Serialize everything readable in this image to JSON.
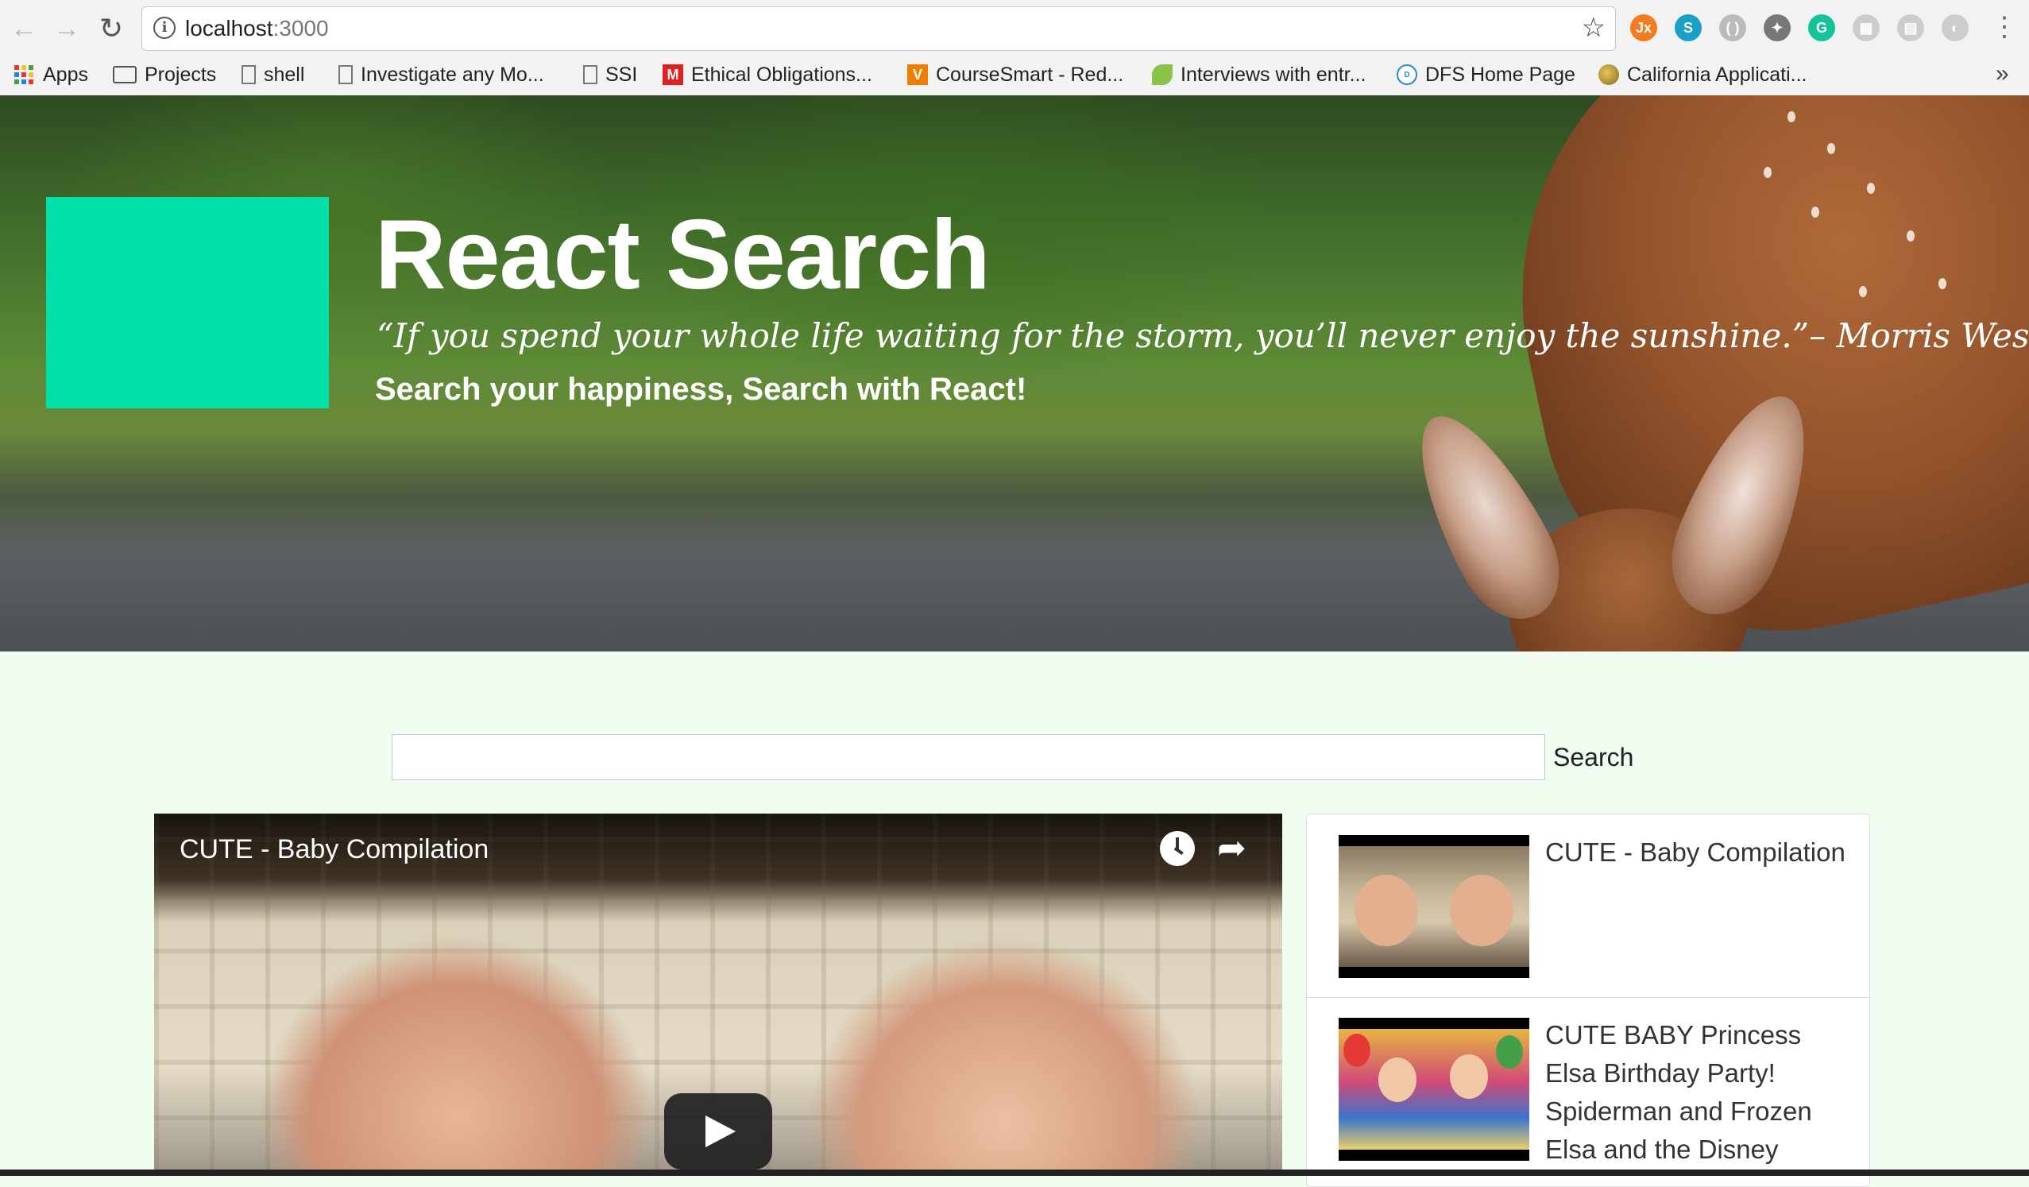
{
  "browser": {
    "url_host": "localhost",
    "url_port": ":3000",
    "menu_glyph": "⋮",
    "extensions": [
      {
        "name": "jsonview-extension-icon",
        "label": "Jx",
        "color": "#f47b20"
      },
      {
        "name": "skype-extension-icon",
        "label": "S",
        "color": "#1aa0c6"
      },
      {
        "name": "code-extension-icon",
        "label": "( )",
        "color": "#bbbbbb"
      },
      {
        "name": "puzzle-extension-icon",
        "label": "✦",
        "color": "#777777"
      },
      {
        "name": "grammarly-extension-icon",
        "label": "G",
        "color": "#15c39a"
      },
      {
        "name": "grid-extension-icon",
        "label": "▦",
        "color": "#cccccc"
      },
      {
        "name": "page-extension-icon",
        "label": "▤",
        "color": "#cccccc"
      },
      {
        "name": "leaf-extension-icon",
        "label": "◐",
        "color": "#cccccc"
      }
    ]
  },
  "bookmarks": [
    {
      "label": "Apps",
      "icon": "apps-grid-icon"
    },
    {
      "label": "Projects",
      "icon": "folder-icon"
    },
    {
      "label": "shell",
      "icon": "page-icon"
    },
    {
      "label": "Investigate any Mo...",
      "icon": "page-icon"
    },
    {
      "label": "SSI",
      "icon": "page-icon"
    },
    {
      "label": "Ethical Obligations...",
      "icon": "m-logo-icon",
      "color": "#e02020",
      "letter": "M"
    },
    {
      "label": "CourseSmart - Red...",
      "icon": "v-logo-icon",
      "color": "#f07d00",
      "letter": "V"
    },
    {
      "label": "Interviews with entr...",
      "icon": "leaf-icon",
      "color": "#8bc34a",
      "letter": ""
    },
    {
      "label": "DFS Home Page",
      "icon": "dell-logo-icon",
      "color": "#2a8ad4",
      "letter": "D"
    },
    {
      "label": "California Applicati...",
      "icon": "globe-icon",
      "color": "#c9a03a",
      "letter": ""
    }
  ],
  "bookmarks_more": "»",
  "hero": {
    "title": "React Search",
    "quote": "“If you spend your whole life waiting for the storm, you’ll never enjoy the sunshine.”– Morris West",
    "subtitle": "Search your happiness, Search with React!",
    "logo_color": "#00e0a8"
  },
  "search": {
    "value": "",
    "label": "Search"
  },
  "player": {
    "title": "CUTE - Baby Compilation"
  },
  "video_list": [
    {
      "title": "CUTE - Baby Compilation"
    },
    {
      "title": "CUTE BABY Princess Elsa Birthday Party! Spiderman and Frozen Elsa and the Disney"
    }
  ]
}
